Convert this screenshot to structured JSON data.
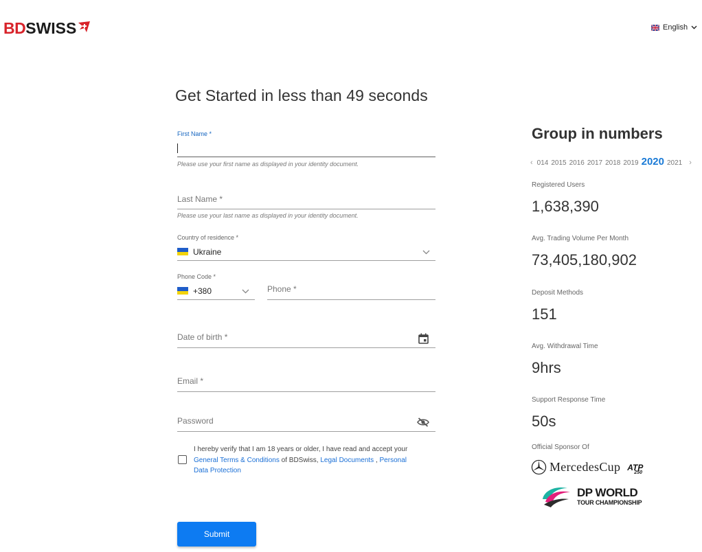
{
  "header": {
    "logo_part1": "BD",
    "logo_part2": "SWISS",
    "language": "English"
  },
  "form": {
    "title": "Get Started in less than 49 seconds",
    "first_name": {
      "label": "First Name *",
      "value": "",
      "hint": "Please use your first name as displayed in your identity document."
    },
    "last_name": {
      "label": "Last Name *",
      "hint": "Please use your last name as displayed in your identity document."
    },
    "country": {
      "label": "Country of residence *",
      "value": "Ukraine"
    },
    "phone_code": {
      "label": "Phone Code *",
      "value": "+380"
    },
    "phone": {
      "label": "Phone *"
    },
    "dob": {
      "label": "Date of birth *"
    },
    "email": {
      "label": "Email *"
    },
    "password": {
      "label": "Password"
    },
    "consent": {
      "text1": "I hereby verify that I am 18 years or older, I have read and accept your",
      "link1": "General Terms & Conditions",
      "text2": " of BDSwiss, ",
      "link2": "Legal Documents",
      "text3": " , ",
      "link3": "Personal Data Protection"
    },
    "submit_label": "Submit"
  },
  "panel": {
    "title": "Group in numbers",
    "years": [
      "014",
      "2015",
      "2016",
      "2017",
      "2018",
      "2019",
      "2020",
      "2021"
    ],
    "selected_year": "2020",
    "stats": [
      {
        "label": "Registered Users",
        "value": "1,638,390"
      },
      {
        "label": "Avg. Trading Volume Per Month",
        "value": "73,405,180,902"
      },
      {
        "label": "Deposit Methods",
        "value": "151"
      },
      {
        "label": "Avg. Withdrawal Time",
        "value": "9hrs"
      },
      {
        "label": "Support Response Time",
        "value": "50s"
      }
    ],
    "sponsor_label": "Official Sponsor Of",
    "sponsor1": "MercedesCup",
    "sponsor1_badge": "ATP",
    "sponsor1_badge_sub": "250",
    "sponsor2_line1": "DP WORLD",
    "sponsor2_line2": "TOUR CHAMPIONSHIP"
  },
  "colors": {
    "brand_red": "#d8232a",
    "accent_blue": "#0d7bf2",
    "link_blue": "#1a6fd6"
  }
}
